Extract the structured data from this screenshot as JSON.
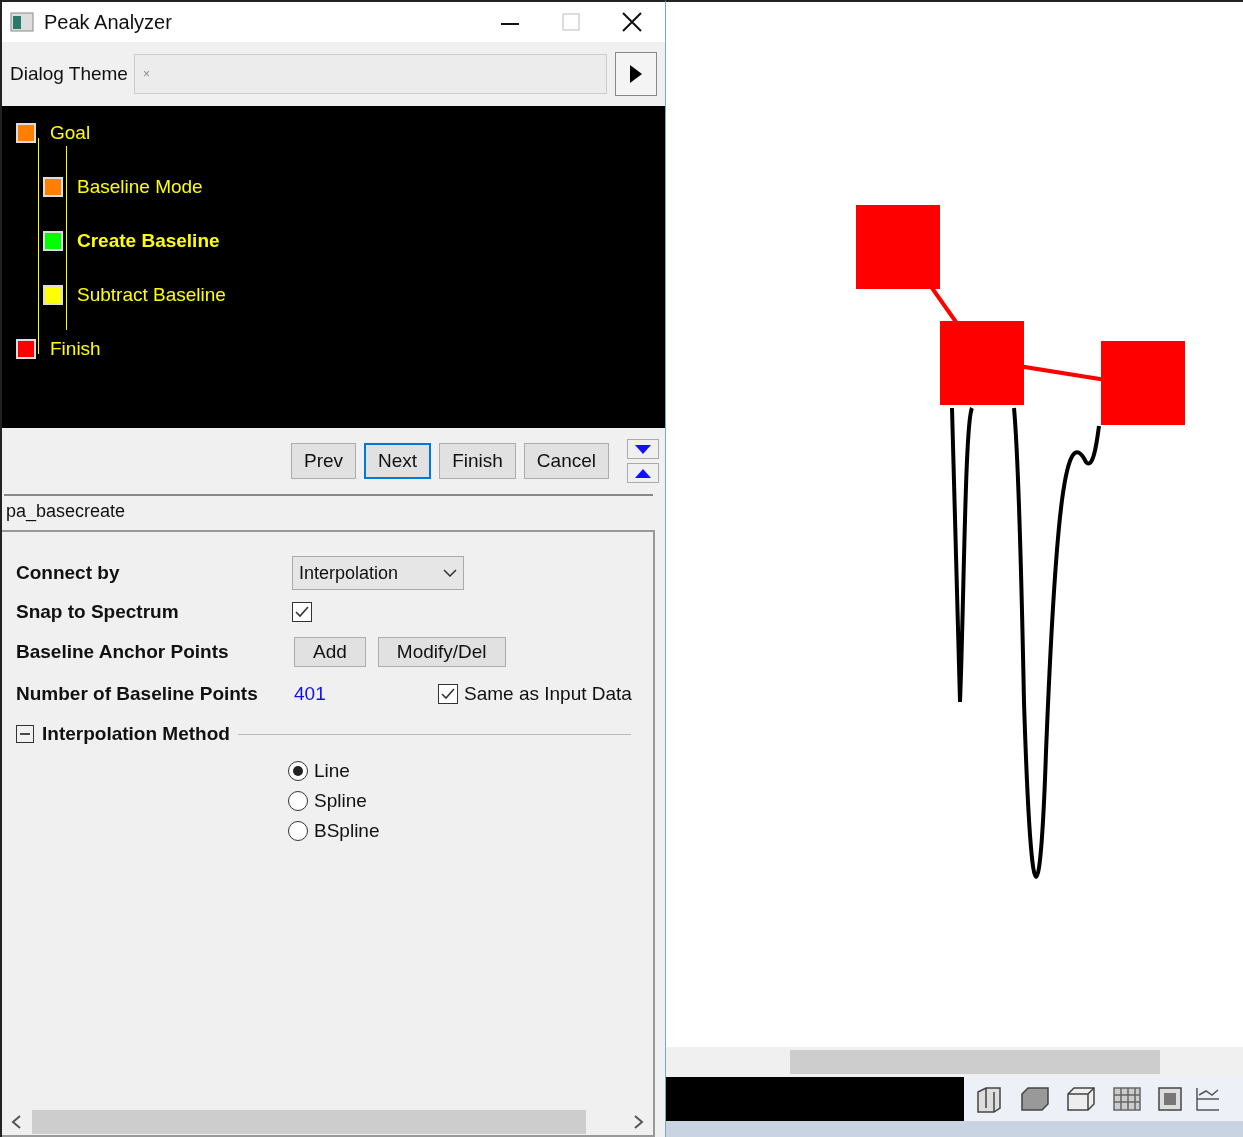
{
  "window": {
    "title": "Peak Analyzer"
  },
  "theme": {
    "label": "Dialog Theme",
    "value": "×"
  },
  "tree": [
    {
      "label": "Goal",
      "color": "#ff8000",
      "selected": false,
      "children": [
        {
          "label": "Baseline Mode",
          "color": "#ff8000",
          "selected": false
        },
        {
          "label": "Create Baseline",
          "color": "#00ff00",
          "selected": true
        },
        {
          "label": "Subtract Baseline",
          "color": "#ffff00",
          "selected": false
        }
      ]
    },
    {
      "label": "Finish",
      "color": "#ff0000",
      "selected": false
    }
  ],
  "nav_buttons": [
    {
      "label": "Prev",
      "selected": false
    },
    {
      "label": "Next",
      "selected": true
    },
    {
      "label": "Finish",
      "selected": false
    },
    {
      "label": "Cancel",
      "selected": false
    }
  ],
  "page_name": "pa_basecreate",
  "settings": {
    "connect_by": {
      "label": "Connect by",
      "value": "Interpolation"
    },
    "snap": {
      "label": "Snap to Spectrum",
      "checked": true
    },
    "anchor": {
      "label": "Baseline Anchor Points",
      "buttons": [
        "Add",
        "Modify/Del"
      ]
    },
    "points": {
      "label": "Number of Baseline Points",
      "value": "401",
      "same_label": "Same as Input Data",
      "same_checked": true
    },
    "method": {
      "label": "Interpolation Method",
      "expanded": true,
      "options": [
        {
          "label": "Line",
          "selected": true
        },
        {
          "label": "Spline",
          "selected": false
        },
        {
          "label": "BSpline",
          "selected": false
        }
      ]
    }
  }
}
